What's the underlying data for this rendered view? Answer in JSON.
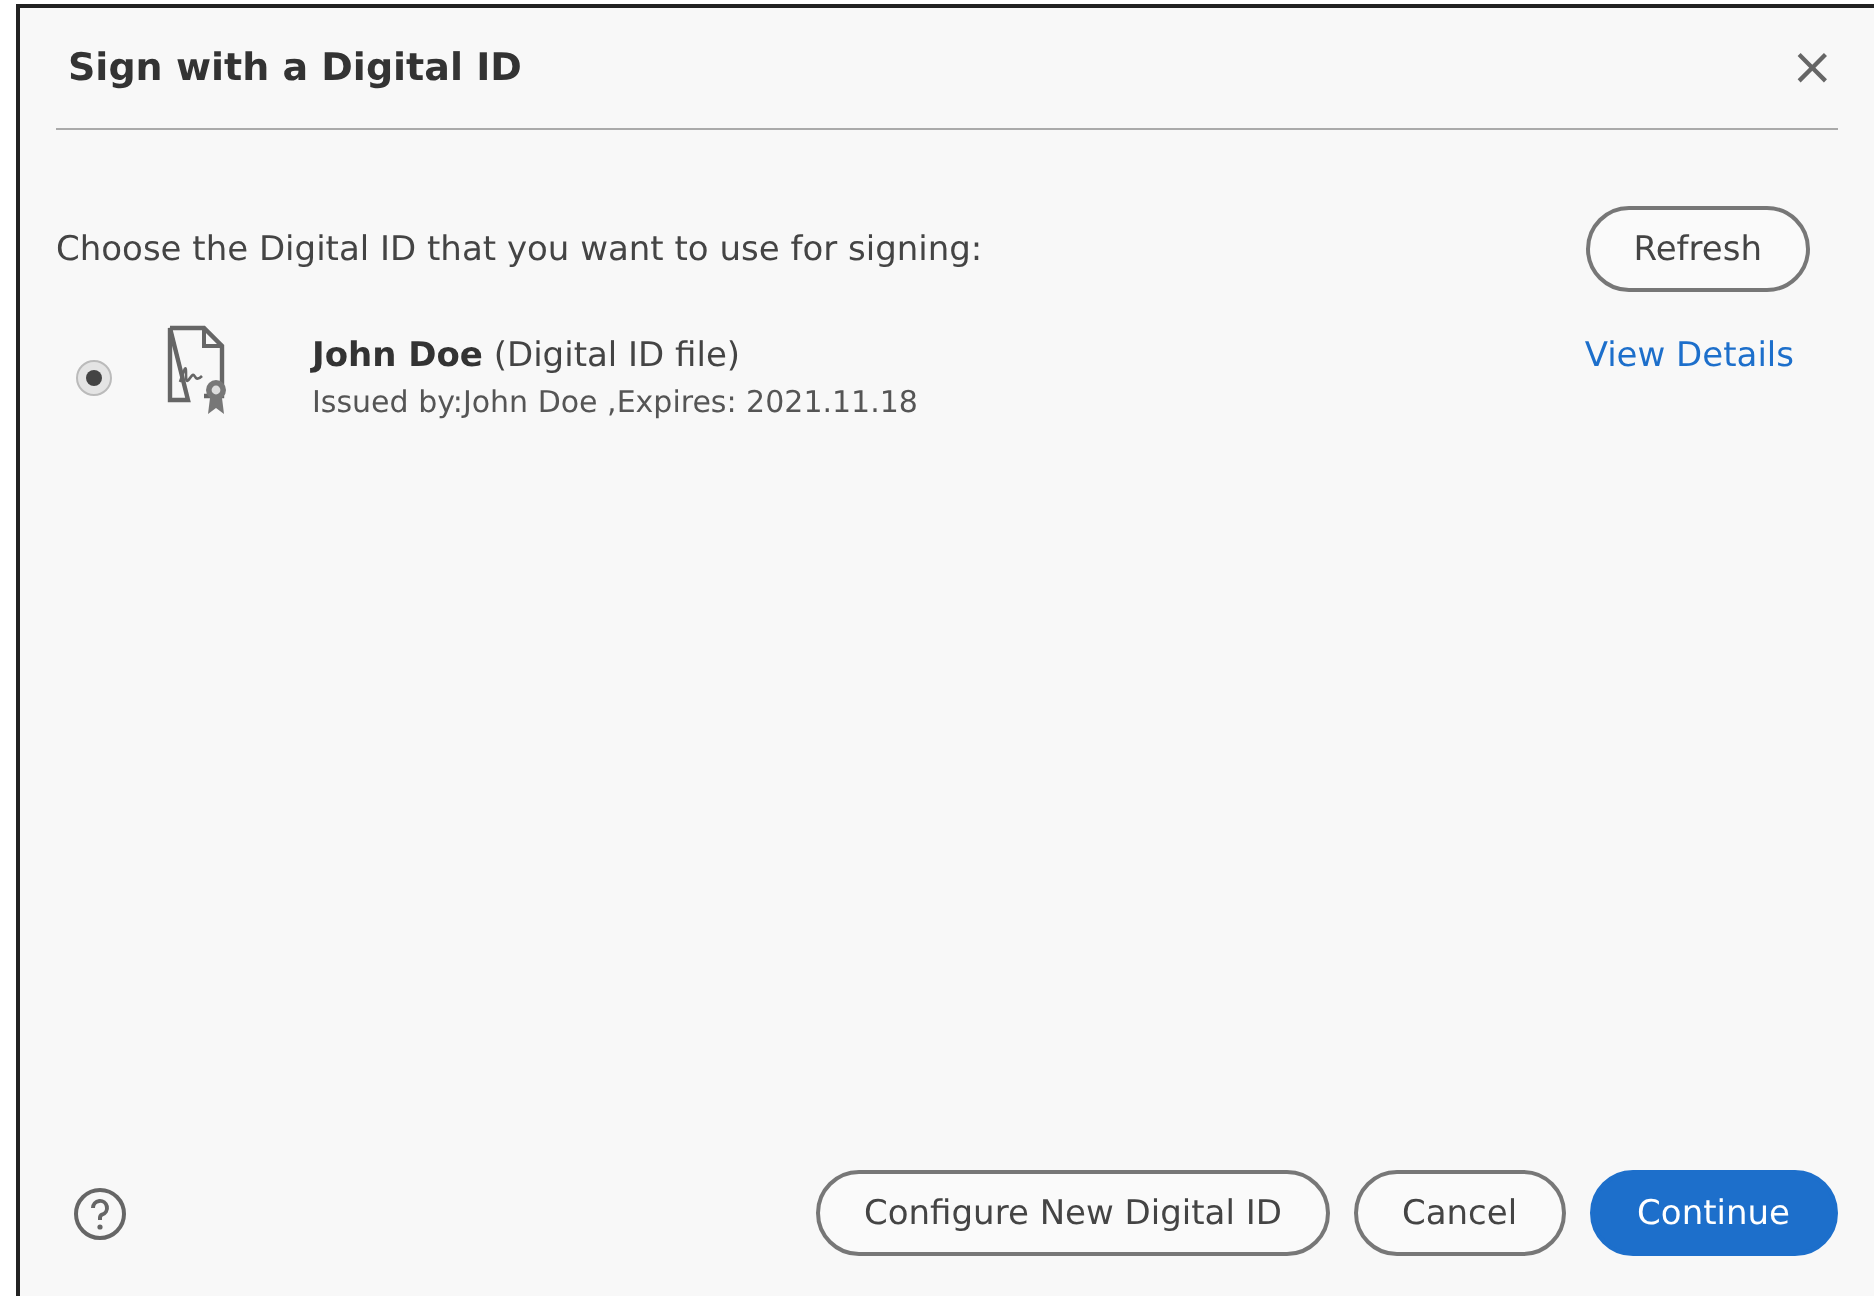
{
  "window": {
    "title": "Sign with a Digital ID",
    "close": "×"
  },
  "prompt": "Choose the Digital ID that you want to use for signing:",
  "refresh_button": "Refresh",
  "ids": [
    {
      "name": "**John Doe** (Digital ID file)",
      "issuer": "Issued by:John Doe ,Expires: 2021.11.18",
      "selected": true,
      "link": "View Details"
    }
  ],
  "buttons": [
    {
      "label": "Configure New Digital ID",
      "kind": "secondary"
    },
    {
      "label": "Cancel",
      "kind": "secondary"
    },
    {
      "label": "Continue",
      "kind": "primary"
    }
  ]
}
